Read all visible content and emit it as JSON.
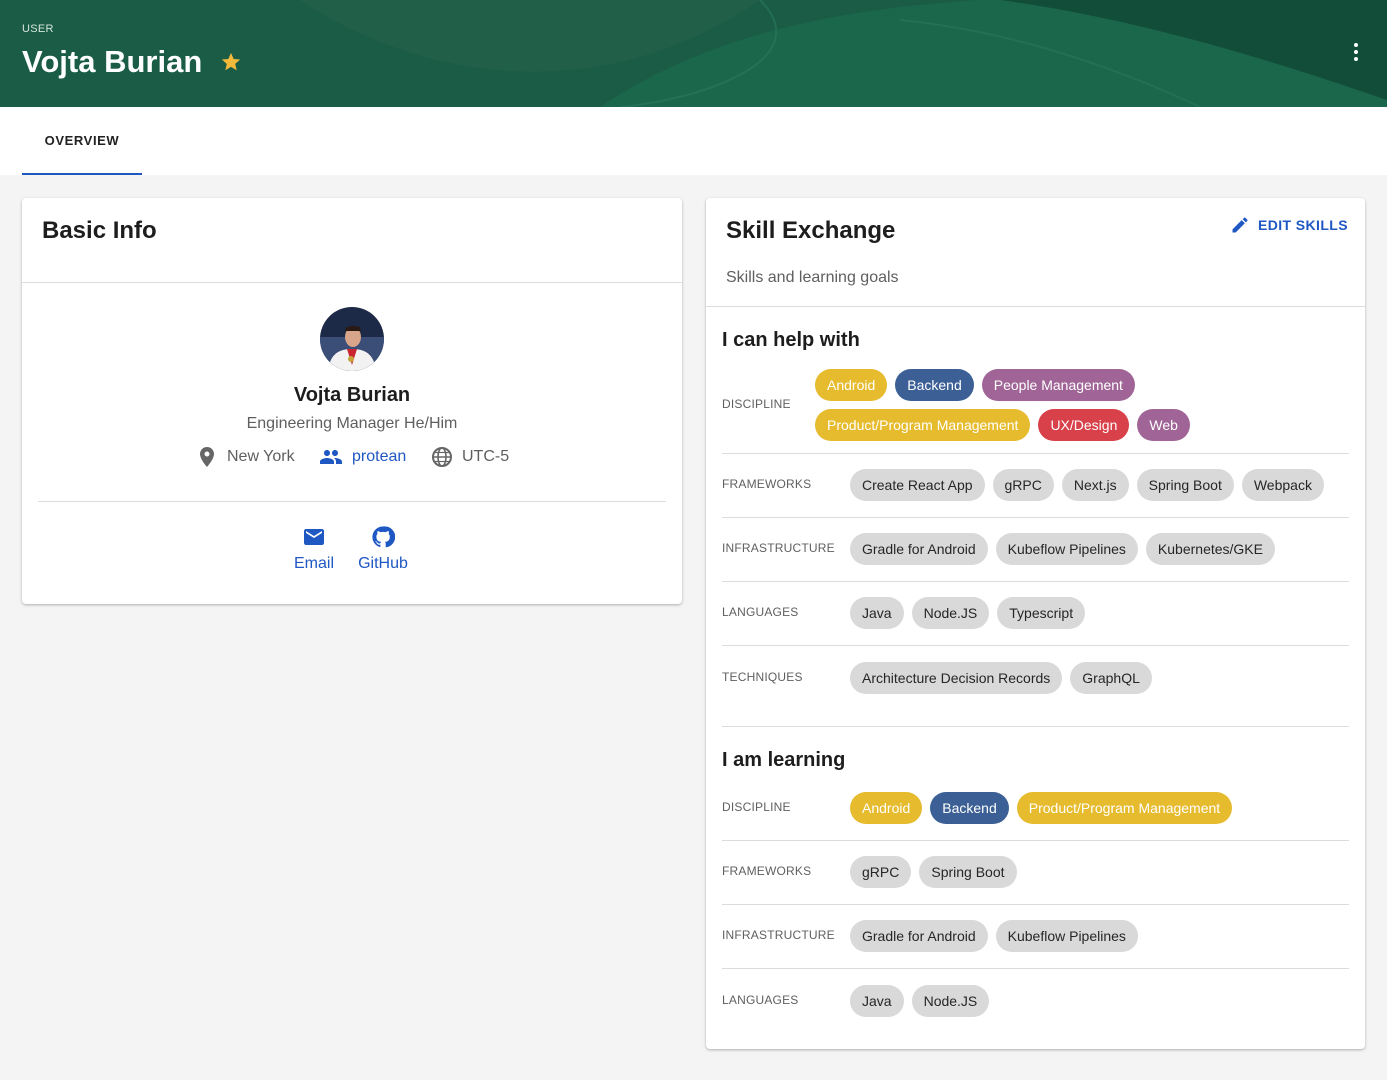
{
  "header": {
    "type_label": "USER",
    "title": "Vojta Burian",
    "star_color": "#f2b93b",
    "background": "#1a5c45",
    "menu_icon": "more-vert-icon"
  },
  "tabs": [
    {
      "label": "OVERVIEW",
      "active": true
    }
  ],
  "basic_info": {
    "title": "Basic Info",
    "name": "Vojta Burian",
    "role": "Engineering Manager He/Him",
    "location": "New York",
    "team": "protean",
    "timezone": "UTC-5",
    "contacts": [
      {
        "label": "Email",
        "icon": "email-icon"
      },
      {
        "label": "GitHub",
        "icon": "github-icon"
      }
    ]
  },
  "skills": {
    "title": "Skill Exchange",
    "subtitle": "Skills and learning goals",
    "edit_label": "EDIT SKILLS",
    "help_title": "I can help with",
    "learn_title": "I am learning",
    "help": {
      "discipline_label": "DISCIPLINE",
      "discipline": [
        {
          "label": "Android",
          "color": "#e6bb2e"
        },
        {
          "label": "Backend",
          "color": "#3c6095"
        },
        {
          "label": "People Management",
          "color": "#a06596"
        },
        {
          "label": "Product/Program Management",
          "color": "#e6bb2e"
        },
        {
          "label": "UX/Design",
          "color": "#d8404a"
        },
        {
          "label": "Web",
          "color": "#a06596"
        }
      ],
      "frameworks_label": "FRAMEWORKS",
      "frameworks": [
        "Create React App",
        "gRPC",
        "Next.js",
        "Spring Boot",
        "Webpack"
      ],
      "infrastructure_label": "INFRASTRUCTURE",
      "infrastructure": [
        "Gradle for Android",
        "Kubeflow Pipelines",
        "Kubernetes/GKE"
      ],
      "languages_label": "LANGUAGES",
      "languages": [
        "Java",
        "Node.JS",
        "Typescript"
      ],
      "techniques_label": "TECHNIQUES",
      "techniques": [
        "Architecture Decision Records",
        "GraphQL"
      ]
    },
    "learn": {
      "discipline_label": "DISCIPLINE",
      "discipline": [
        {
          "label": "Android",
          "color": "#e6bb2e"
        },
        {
          "label": "Backend",
          "color": "#3c6095"
        },
        {
          "label": "Product/Program Management",
          "color": "#e6bb2e"
        }
      ],
      "frameworks_label": "FRAMEWORKS",
      "frameworks": [
        "gRPC",
        "Spring Boot"
      ],
      "infrastructure_label": "INFRASTRUCTURE",
      "infrastructure": [
        "Gradle for Android",
        "Kubeflow Pipelines"
      ],
      "languages_label": "LANGUAGES",
      "languages": [
        "Java",
        "Node.JS"
      ]
    }
  }
}
